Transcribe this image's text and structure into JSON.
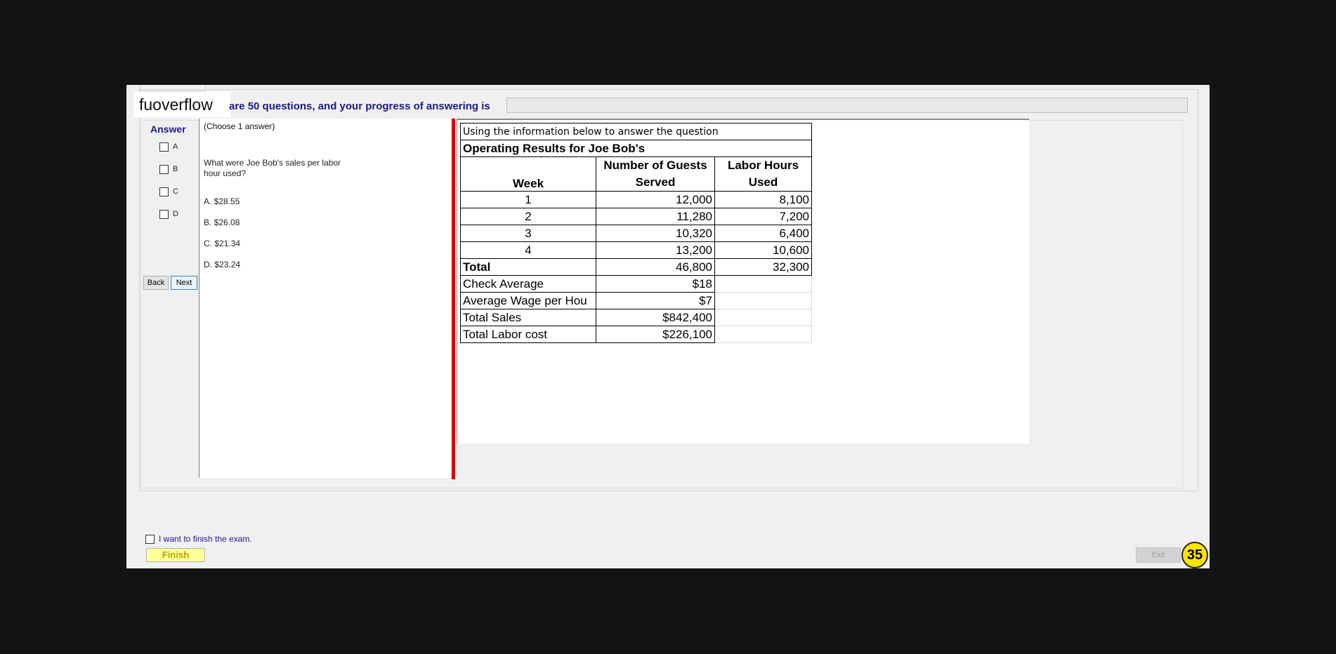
{
  "header": {
    "logo": "fuoverflow",
    "progress_text": "are 50 questions, and your progress of answering is"
  },
  "answer_panel": {
    "title": "Answer",
    "options": [
      "A",
      "B",
      "C",
      "D"
    ],
    "back_label": "Back",
    "next_label": "Next"
  },
  "question": {
    "instruction": "(Choose 1 answer)",
    "text": "What were Joe Bob's sales per labor hour used?",
    "choices": [
      "A.  $28.55",
      "B.  $26.08",
      "C.  $21.34",
      "D.  $23.24"
    ]
  },
  "context": {
    "intro": "Using the information below to answer the question",
    "title": "Operating Results for Joe Bob's",
    "headers": [
      "Week",
      "Number of Guests Served",
      "Labor Hours Used"
    ],
    "rows": [
      [
        "1",
        "12,000",
        "8,100"
      ],
      [
        "2",
        "11,280",
        "7,200"
      ],
      [
        "3",
        "10,320",
        "6,400"
      ],
      [
        "4",
        "13,200",
        "10,600"
      ]
    ],
    "total": [
      "Total",
      "46,800",
      "32,300"
    ],
    "summary": [
      [
        "Check Average",
        "$18"
      ],
      [
        "Average Wage per Hou",
        "$7"
      ],
      [
        "Total Sales",
        "$842,400"
      ],
      [
        "Total Labor cost",
        "$226,100"
      ]
    ]
  },
  "footer": {
    "finish_check_label": "I want to finish the exam.",
    "finish_label": "Finish",
    "exit_label": "Exit",
    "timer": "35"
  }
}
